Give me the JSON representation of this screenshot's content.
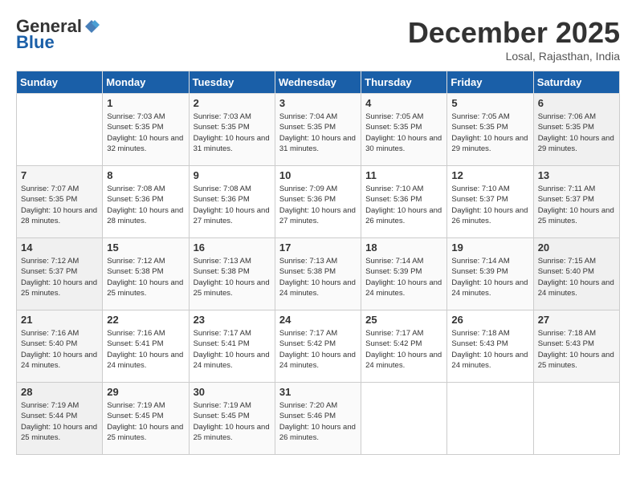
{
  "header": {
    "logo_general": "General",
    "logo_blue": "Blue",
    "month_title": "December 2025",
    "location": "Losal, Rajasthan, India"
  },
  "days_of_week": [
    "Sunday",
    "Monday",
    "Tuesday",
    "Wednesday",
    "Thursday",
    "Friday",
    "Saturday"
  ],
  "weeks": [
    [
      {
        "num": "",
        "empty": true
      },
      {
        "num": "1",
        "sunrise": "7:03 AM",
        "sunset": "5:35 PM",
        "daylight": "10 hours and 32 minutes."
      },
      {
        "num": "2",
        "sunrise": "7:03 AM",
        "sunset": "5:35 PM",
        "daylight": "10 hours and 31 minutes."
      },
      {
        "num": "3",
        "sunrise": "7:04 AM",
        "sunset": "5:35 PM",
        "daylight": "10 hours and 31 minutes."
      },
      {
        "num": "4",
        "sunrise": "7:05 AM",
        "sunset": "5:35 PM",
        "daylight": "10 hours and 30 minutes."
      },
      {
        "num": "5",
        "sunrise": "7:05 AM",
        "sunset": "5:35 PM",
        "daylight": "10 hours and 29 minutes."
      },
      {
        "num": "6",
        "sunrise": "7:06 AM",
        "sunset": "5:35 PM",
        "daylight": "10 hours and 29 minutes."
      }
    ],
    [
      {
        "num": "7",
        "sunrise": "7:07 AM",
        "sunset": "5:35 PM",
        "daylight": "10 hours and 28 minutes."
      },
      {
        "num": "8",
        "sunrise": "7:08 AM",
        "sunset": "5:36 PM",
        "daylight": "10 hours and 28 minutes."
      },
      {
        "num": "9",
        "sunrise": "7:08 AM",
        "sunset": "5:36 PM",
        "daylight": "10 hours and 27 minutes."
      },
      {
        "num": "10",
        "sunrise": "7:09 AM",
        "sunset": "5:36 PM",
        "daylight": "10 hours and 27 minutes."
      },
      {
        "num": "11",
        "sunrise": "7:10 AM",
        "sunset": "5:36 PM",
        "daylight": "10 hours and 26 minutes."
      },
      {
        "num": "12",
        "sunrise": "7:10 AM",
        "sunset": "5:37 PM",
        "daylight": "10 hours and 26 minutes."
      },
      {
        "num": "13",
        "sunrise": "7:11 AM",
        "sunset": "5:37 PM",
        "daylight": "10 hours and 25 minutes."
      }
    ],
    [
      {
        "num": "14",
        "sunrise": "7:12 AM",
        "sunset": "5:37 PM",
        "daylight": "10 hours and 25 minutes."
      },
      {
        "num": "15",
        "sunrise": "7:12 AM",
        "sunset": "5:38 PM",
        "daylight": "10 hours and 25 minutes."
      },
      {
        "num": "16",
        "sunrise": "7:13 AM",
        "sunset": "5:38 PM",
        "daylight": "10 hours and 25 minutes."
      },
      {
        "num": "17",
        "sunrise": "7:13 AM",
        "sunset": "5:38 PM",
        "daylight": "10 hours and 24 minutes."
      },
      {
        "num": "18",
        "sunrise": "7:14 AM",
        "sunset": "5:39 PM",
        "daylight": "10 hours and 24 minutes."
      },
      {
        "num": "19",
        "sunrise": "7:14 AM",
        "sunset": "5:39 PM",
        "daylight": "10 hours and 24 minutes."
      },
      {
        "num": "20",
        "sunrise": "7:15 AM",
        "sunset": "5:40 PM",
        "daylight": "10 hours and 24 minutes."
      }
    ],
    [
      {
        "num": "21",
        "sunrise": "7:16 AM",
        "sunset": "5:40 PM",
        "daylight": "10 hours and 24 minutes."
      },
      {
        "num": "22",
        "sunrise": "7:16 AM",
        "sunset": "5:41 PM",
        "daylight": "10 hours and 24 minutes."
      },
      {
        "num": "23",
        "sunrise": "7:17 AM",
        "sunset": "5:41 PM",
        "daylight": "10 hours and 24 minutes."
      },
      {
        "num": "24",
        "sunrise": "7:17 AM",
        "sunset": "5:42 PM",
        "daylight": "10 hours and 24 minutes."
      },
      {
        "num": "25",
        "sunrise": "7:17 AM",
        "sunset": "5:42 PM",
        "daylight": "10 hours and 24 minutes."
      },
      {
        "num": "26",
        "sunrise": "7:18 AM",
        "sunset": "5:43 PM",
        "daylight": "10 hours and 24 minutes."
      },
      {
        "num": "27",
        "sunrise": "7:18 AM",
        "sunset": "5:43 PM",
        "daylight": "10 hours and 25 minutes."
      }
    ],
    [
      {
        "num": "28",
        "sunrise": "7:19 AM",
        "sunset": "5:44 PM",
        "daylight": "10 hours and 25 minutes."
      },
      {
        "num": "29",
        "sunrise": "7:19 AM",
        "sunset": "5:45 PM",
        "daylight": "10 hours and 25 minutes."
      },
      {
        "num": "30",
        "sunrise": "7:19 AM",
        "sunset": "5:45 PM",
        "daylight": "10 hours and 25 minutes."
      },
      {
        "num": "31",
        "sunrise": "7:20 AM",
        "sunset": "5:46 PM",
        "daylight": "10 hours and 26 minutes."
      },
      {
        "num": "",
        "empty": true
      },
      {
        "num": "",
        "empty": true
      },
      {
        "num": "",
        "empty": true
      }
    ]
  ],
  "labels": {
    "sunrise_prefix": "Sunrise: ",
    "sunset_prefix": "Sunset: ",
    "daylight_prefix": "Daylight: "
  }
}
